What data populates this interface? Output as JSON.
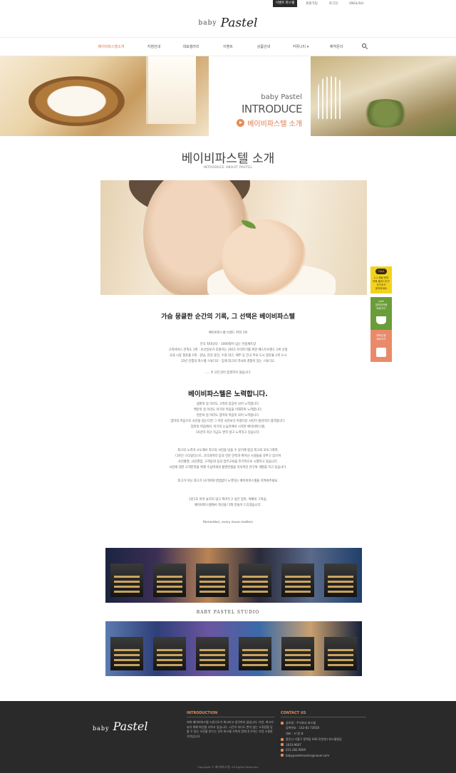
{
  "utility_bar": {
    "items": [
      "이벤트 파스텔",
      "회원가입",
      "로그인",
      "ENGLISH"
    ]
  },
  "logo": {
    "baby": "baby",
    "pastel": "Pastel"
  },
  "nav": {
    "items": [
      "베이비파스텔소개",
      "지점안내",
      "대표갤러리",
      "이벤트",
      "상품안내",
      "커뮤니티",
      "예약문의"
    ],
    "active_color": "#e07a4d"
  },
  "hero": {
    "line1": "baby Pastel",
    "line2": "INTRODUCE",
    "line3": "베이비파스텔 소개"
  },
  "section": {
    "title": "베이비파스텔 소개",
    "subtitle": "INTRODUCE ABOUT PASTEL"
  },
  "block1": {
    "heading": "가슴 뭉클한 순간의 기록, 그 선택은 베이비파스텔",
    "p1": [
      "베이비파스텔 브랜드 파워 1위"
    ],
    "p2": [
      "전국 최대규모 · 1000평이 넘는 전용세트장",
      "고객서비스 만족도 1위 · 조선일보가 후원하는 2015 우리아기를 위한 베스트브랜드 1위 선정",
      "국내 시장 점유율 1위 · 강남, 분당 용인, 수원 대구, 제주 등 전국 주요 도시 점유율 1위 도시",
      "15년 전통의 파스텔 스튜디오 · 업계 최고의 역사와 경험이 있는 스튜디오."
    ],
    "p3": [
      "..... 이 모든것이 증명하지 않습니다."
    ]
  },
  "block2": {
    "heading": "베이비파스텔은 노력합니다.",
    "p1": [
      "섬환의 일 이라도 고객의 입장이 되어 노력합니다.",
      "백분의 일 이라도 아기의 마음을 이해하며 노력합니다.",
      "천분의 일 이라도 엄마의 마음이 되어 노력합니다.",
      "엄마의 마음으로 사진을 담는다면 그 어떤 사진보다 아름다운 사진이 될것이라 생각합니다.",
      "엄마의 마음에서, 아기의 눈높이에서 시작한 베이비파스텔,",
      "15년이 지난 지금도 변치 않고 노력하고 있습니다."
    ],
    "p2": [
      "최고의 노력과 시도에서 최고의 사진을 담을 수 있기에 항상 최고의 포토그래퍼,",
      "디자인 스타일리스트, 코디네이터 등의 전문 인력과 뛰어난 시설들을 갖추고 있으며",
      "사진촬영, 사진편집, 고객응대 등의 업무교육을 주기적으로 시행하고 있습니다.",
      "사진에 대한 고객만족을 위해 수십여개의 촬영컨셉을 지속적인 연구와 개발을 하고 있습니다."
    ],
    "p3": [
      "최고가 아닌 최고가 되기위해 변함없이 노력하는 베이비파스텔을 지켜봐주세요."
    ],
    "p4": [
      "1분1초 마저 놓치지 않고 찍어두고 싶은 엄마, 아빠의 그마음,",
      "베이비파스텔에서 최선을 다해 만들어 드리겠습니다."
    ],
    "p5": [
      "Remember, every move matters"
    ]
  },
  "side_widgets": {
    "kakao": {
      "badge": "TALK",
      "lines": [
        "1:1 채팅 문의",
        "카톡 플러스친구",
        "친구추가",
        "문의하세요"
      ],
      "color": "#f3d31a"
    },
    "cafe": {
      "lines": [
        "cafe",
        "온라인카페",
        "바로가기"
      ],
      "color": "#6b9c3a"
    },
    "reserve": {
      "lines": [
        "예약신청",
        "바로가기"
      ],
      "color": "#e98b6b"
    }
  },
  "studio": {
    "label": "BABY PASTEL STUDIO"
  },
  "footer": {
    "intro_heading": "INTRODUCTION",
    "intro_text": "저희 베이비파스텔 스튜디오가 최고라고 생각하지 않습니다. 다만, 최고가 되기 위해 최선을 다하고 있습니다. 시간이 지나도 변치 않는 고귀함을 담을 수 있는 사진을 만드는 것이 파스텔 가족의 함께 추구하는 가장 소중한 가치입니다.",
    "contact_heading": "CONTACT US",
    "contact_rows": [
      {
        "text": "상호명 : 주식회사 파스텔",
        "icon": true
      },
      {
        "text": "등록번호 : 142-81-72658",
        "icon": false
      },
      {
        "text": "대표 : 서 정 효",
        "icon": false
      },
      {
        "text": "용인시 기흥구 동백동 445-2(번지) 파스텔빌딩",
        "icon": true
      },
      {
        "text": "1833-9607",
        "icon": true
      },
      {
        "text": "031.282.9609",
        "icon": true
      },
      {
        "text": "babypastelmaster@naver.com",
        "icon": true
      }
    ],
    "copyright": "Copyright © 베이비파스텔. All Rights Reserved.",
    "accent_color": "#e08a5a"
  }
}
